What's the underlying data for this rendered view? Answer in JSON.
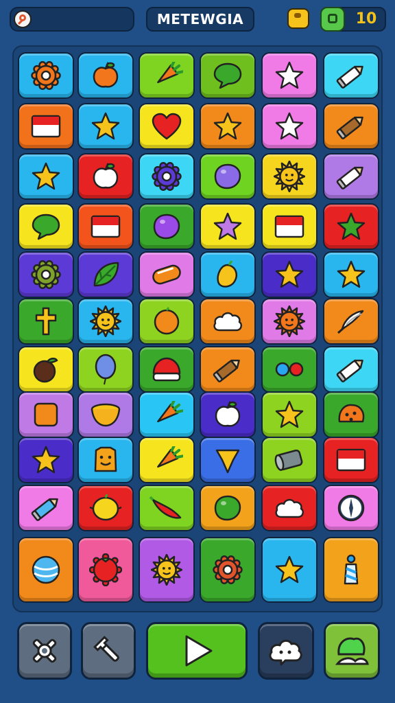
{
  "header": {
    "search_icon": "magnifier-icon",
    "title": "METEWGIA",
    "coin_icon": "coin-icon",
    "gem_icon": "gem-icon",
    "counter_value": "10"
  },
  "board": {
    "columns": 6,
    "rows": 11,
    "tiles": [
      {
        "color": "#29b6ef",
        "icon": "gear-icon"
      },
      {
        "color": "#29b6ef",
        "icon": "bird-icon"
      },
      {
        "color": "#7fd321",
        "icon": "carrot-icon"
      },
      {
        "color": "#6fbf1f",
        "icon": "speech-bubble-icon"
      },
      {
        "color": "#f07ae6",
        "icon": "star-icon"
      },
      {
        "color": "#3dd6f5",
        "icon": "pencil-icon"
      },
      {
        "color": "#f2711b",
        "icon": "flag-icon"
      },
      {
        "color": "#29b6ef",
        "icon": "star-icon"
      },
      {
        "color": "#f6e51e",
        "icon": "heart-icon"
      },
      {
        "color": "#f2891b",
        "icon": "star-icon"
      },
      {
        "color": "#f07ae6",
        "icon": "star-icon"
      },
      {
        "color": "#f2891b",
        "icon": "pencil-icon"
      },
      {
        "color": "#29b6ef",
        "icon": "star-icon"
      },
      {
        "color": "#e62222",
        "icon": "apple-icon"
      },
      {
        "color": "#3dd6f5",
        "icon": "gear-icon"
      },
      {
        "color": "#6fd321",
        "icon": "blob-icon"
      },
      {
        "color": "#f6d51e",
        "icon": "sun-icon"
      },
      {
        "color": "#b07ae6",
        "icon": "pencil-icon"
      },
      {
        "color": "#f6e51e",
        "icon": "leaf-icon"
      },
      {
        "color": "#f2541b",
        "icon": "flag-icon"
      },
      {
        "color": "#3aa82a",
        "icon": "blob-icon"
      },
      {
        "color": "#f6e51e",
        "icon": "star-icon"
      },
      {
        "color": "#f6e51e",
        "icon": "flag-icon"
      },
      {
        "color": "#e62222",
        "icon": "star-icon"
      },
      {
        "color": "#5c3ad6",
        "icon": "gear-icon"
      },
      {
        "color": "#5c3ad6",
        "icon": "leaf-icon"
      },
      {
        "color": "#e07ae6",
        "icon": "candy-icon"
      },
      {
        "color": "#29b6ef",
        "icon": "mango-icon"
      },
      {
        "color": "#4a2cc8",
        "icon": "star-icon"
      },
      {
        "color": "#29b6ef",
        "icon": "star-icon"
      },
      {
        "color": "#3aa82a",
        "icon": "cross-icon"
      },
      {
        "color": "#29b6ef",
        "icon": "sun-icon"
      },
      {
        "color": "#8fd321",
        "icon": "orange-icon"
      },
      {
        "color": "#f2891b",
        "icon": "cloud-icon"
      },
      {
        "color": "#e07ae6",
        "icon": "sun-icon"
      },
      {
        "color": "#f2891b",
        "icon": "feather-icon"
      },
      {
        "color": "#f6e51e",
        "icon": "nut-icon"
      },
      {
        "color": "#8fd321",
        "icon": "balloon-icon"
      },
      {
        "color": "#3aa82a",
        "icon": "mushroom-icon"
      },
      {
        "color": "#f2891b",
        "icon": "pencil-icon"
      },
      {
        "color": "#3aa82a",
        "icon": "dots-icon"
      },
      {
        "color": "#3dd6f5",
        "icon": "pencil-icon"
      },
      {
        "color": "#c07ae6",
        "icon": "square-icon"
      },
      {
        "color": "#b07ae6",
        "icon": "bowl-icon"
      },
      {
        "color": "#29c6f5",
        "icon": "carrot-icon"
      },
      {
        "color": "#4a2cc8",
        "icon": "apple-icon"
      },
      {
        "color": "#8fd321",
        "icon": "star-icon"
      },
      {
        "color": "#3aa82a",
        "icon": "cookie-icon"
      },
      {
        "color": "#4a2cc8",
        "icon": "star-icon"
      },
      {
        "color": "#29b6ef",
        "icon": "face-icon"
      },
      {
        "color": "#f6e51e",
        "icon": "carrot-icon"
      },
      {
        "color": "#3a6ee6",
        "icon": "shield-icon"
      },
      {
        "color": "#8fd321",
        "icon": "can-icon"
      },
      {
        "color": "#e62222",
        "icon": "flag-icon"
      },
      {
        "color": "#f07ae6",
        "icon": "pencil-icon"
      },
      {
        "color": "#e62222",
        "icon": "lemon-icon"
      },
      {
        "color": "#7fd321",
        "icon": "chili-icon"
      },
      {
        "color": "#f2a21b",
        "icon": "blob-icon"
      },
      {
        "color": "#e62222",
        "icon": "cloud-icon"
      },
      {
        "color": "#f07ae6",
        "icon": "compass-icon"
      },
      {
        "color": "#f2891b",
        "icon": "ball-icon"
      },
      {
        "color": "#f05a9a",
        "icon": "tomato-icon"
      },
      {
        "color": "#b05ae6",
        "icon": "sun-icon"
      },
      {
        "color": "#3aa82a",
        "icon": "gear-icon"
      },
      {
        "color": "#29b6ef",
        "icon": "star-icon"
      },
      {
        "color": "#f2a21b",
        "icon": "bottle-icon"
      }
    ]
  },
  "toolbar": {
    "buttons": [
      {
        "name": "settings-button",
        "icon": "gear-cross-icon",
        "color": "#5e6e80"
      },
      {
        "name": "tool-button",
        "icon": "wrench-icon",
        "color": "#5e6e80"
      },
      {
        "name": "play-button",
        "icon": "play-icon",
        "color": "#55c11e"
      },
      {
        "name": "hint-button",
        "icon": "cloud-icon",
        "color": "#2a3e5e"
      },
      {
        "name": "map-button",
        "icon": "landscape-icon",
        "color": "#7fc23a"
      }
    ]
  }
}
